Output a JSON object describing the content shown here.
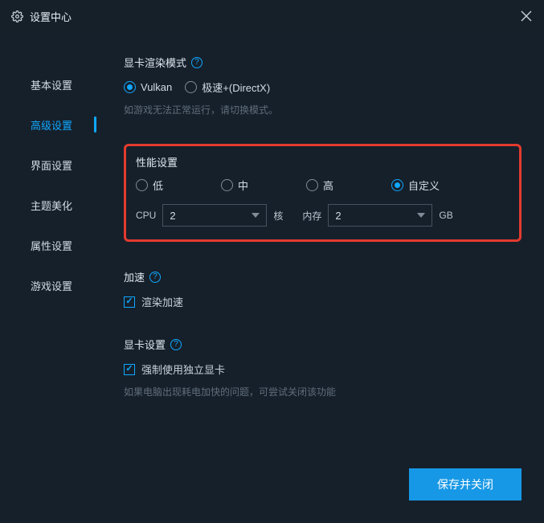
{
  "window": {
    "title": "设置中心"
  },
  "sidebar": {
    "items": [
      {
        "label": "基本设置"
      },
      {
        "label": "高级设置"
      },
      {
        "label": "界面设置"
      },
      {
        "label": "主题美化"
      },
      {
        "label": "属性设置"
      },
      {
        "label": "游戏设置"
      }
    ],
    "activeIndex": 1
  },
  "render": {
    "title": "显卡渲染模式",
    "options": [
      {
        "label": "Vulkan"
      },
      {
        "label": "极速+(DirectX)"
      }
    ],
    "hint": "如游戏无法正常运行，请切换模式。"
  },
  "perf": {
    "title": "性能设置",
    "options": [
      {
        "label": "低"
      },
      {
        "label": "中"
      },
      {
        "label": "高"
      },
      {
        "label": "自定义"
      }
    ],
    "cpuLabel": "CPU",
    "cpuValue": "2",
    "cpuUnit": "核",
    "memLabel": "内存",
    "memValue": "2",
    "memUnit": "GB"
  },
  "accel": {
    "title": "加速",
    "checkboxLabel": "渲染加速"
  },
  "gpu": {
    "title": "显卡设置",
    "checkboxLabel": "强制使用独立显卡",
    "hint": "如果电脑出现耗电加快的问题，可尝试关闭该功能"
  },
  "footer": {
    "saveLabel": "保存并关闭"
  }
}
